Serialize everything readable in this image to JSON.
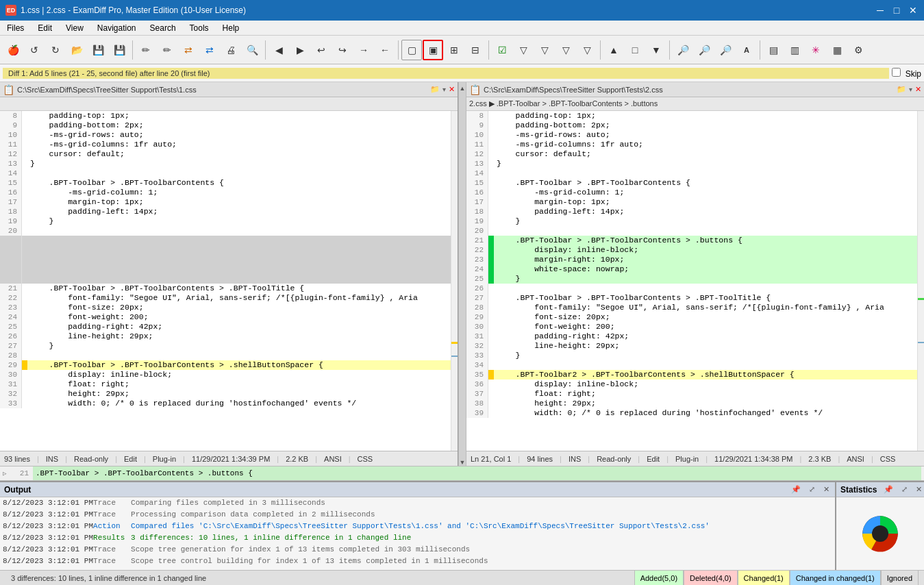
{
  "titlebar": {
    "icon": "ED",
    "title": "1.css | 2.css - ExamDiff Pro, Master Edition (10-User License)",
    "minimize": "─",
    "maximize": "□",
    "close": "✕"
  },
  "menubar": {
    "items": [
      "Files",
      "Edit",
      "View",
      "Navigation",
      "Search",
      "Tools",
      "Help"
    ]
  },
  "toolbar": {
    "buttons": [
      "🍎",
      "↺",
      "↻",
      "📁",
      "💾",
      "💾",
      "✏",
      "✏",
      "🔶",
      "🔷",
      "🖨",
      "🔍",
      "◀",
      "▶",
      "↩",
      "↪",
      "→",
      "←",
      "□",
      "□",
      "▦",
      "▦",
      "▦",
      "▦",
      "☑",
      "▽",
      "▽",
      "▽",
      "▽",
      "▲",
      "□",
      "▼",
      "♦♦",
      "♦♦",
      "♦♦",
      "A",
      "▦",
      "▦",
      "✳",
      "▦",
      "⚙"
    ]
  },
  "diffnav": {
    "label": "Diff 1: Add 5 lines (21 - 25, second file) after line 20 (first file)",
    "skip": "Skip"
  },
  "left_panel": {
    "path": "C:\\Src\\ExamDiff\\Specs\\TreeSitter Support\\Tests\\1.css",
    "breadcrumb": "",
    "lines": [
      {
        "num": 8,
        "content": "    padding-top: 1px;",
        "type": "normal"
      },
      {
        "num": 9,
        "content": "    padding-bottom: 2px;",
        "type": "normal"
      },
      {
        "num": 10,
        "content": "    -ms-grid-rows: auto;",
        "type": "normal"
      },
      {
        "num": 11,
        "content": "    -ms-grid-columns: 1fr auto;",
        "type": "normal"
      },
      {
        "num": 12,
        "content": "    cursor: default;",
        "type": "normal"
      },
      {
        "num": 13,
        "content": "}",
        "type": "normal"
      },
      {
        "num": 14,
        "content": "",
        "type": "normal"
      },
      {
        "num": 15,
        "content": "    .BPT-Toolbar > .BPT-ToolbarContents {",
        "type": "normal"
      },
      {
        "num": 16,
        "content": "        -ms-grid-column: 1;",
        "type": "normal"
      },
      {
        "num": 17,
        "content": "        margin-top: 1px;",
        "type": "normal"
      },
      {
        "num": 18,
        "content": "        padding-left: 14px;",
        "type": "normal"
      },
      {
        "num": 19,
        "content": "    }",
        "type": "normal"
      },
      {
        "num": 20,
        "content": "",
        "type": "normal"
      },
      {
        "num": "",
        "content": "",
        "type": "blank"
      },
      {
        "num": "",
        "content": "",
        "type": "blank"
      },
      {
        "num": "",
        "content": "",
        "type": "blank"
      },
      {
        "num": "",
        "content": "",
        "type": "blank"
      },
      {
        "num": "",
        "content": "",
        "type": "blank"
      },
      {
        "num": 21,
        "content": "    .BPT-Toolbar > .BPT-ToolbarContents > .BPT-ToolTitle {",
        "type": "normal"
      },
      {
        "num": 22,
        "content": "        font-family: \"Segoe UI\", Arial, sans-serif; /*[{plugin-font-family} , Aria",
        "type": "normal"
      },
      {
        "num": 23,
        "content": "        font-size: 20px;",
        "type": "normal"
      },
      {
        "num": 24,
        "content": "        font-weight: 200;",
        "type": "normal"
      },
      {
        "num": 25,
        "content": "        padding-right: 42px;",
        "type": "normal"
      },
      {
        "num": 26,
        "content": "        line-height: 29px;",
        "type": "normal"
      },
      {
        "num": 27,
        "content": "    }",
        "type": "normal"
      },
      {
        "num": 28,
        "content": "",
        "type": "normal"
      },
      {
        "num": 29,
        "content": "    .BPT-Toolbar > .BPT-ToolbarContents > .shellButtonSpacer {",
        "type": "changed"
      },
      {
        "num": 30,
        "content": "        display: inline-block;",
        "type": "normal"
      },
      {
        "num": 31,
        "content": "        float: right;",
        "type": "normal"
      },
      {
        "num": 32,
        "content": "        height: 29px;",
        "type": "normal"
      },
      {
        "num": 33,
        "content": "        width: 0; /* 0 is replaced during 'hostinfochanged' events */",
        "type": "normal"
      }
    ],
    "status": {
      "lines": "93 lines",
      "ins": "INS",
      "readonly": "Read-only",
      "edit": "Edit",
      "plugin": "Plug-in",
      "datetime": "11/29/2021 1:34:39 PM",
      "size": "2.2 KB",
      "encoding": "ANSI",
      "type": "CSS"
    }
  },
  "right_panel": {
    "path": "C:\\Src\\ExamDiff\\Specs\\TreeSitter Support\\Tests\\2.css",
    "breadcrumb": "2.css ▶ .BPT-Toolbar > .BPT-ToolbarContents > .buttons",
    "lines": [
      {
        "num": 8,
        "content": "    padding-top: 1px;",
        "type": "normal"
      },
      {
        "num": 9,
        "content": "    padding-bottom: 2px;",
        "type": "normal"
      },
      {
        "num": 10,
        "content": "    -ms-grid-rows: auto;",
        "type": "normal"
      },
      {
        "num": 11,
        "content": "    -ms-grid-columns: 1fr auto;",
        "type": "normal"
      },
      {
        "num": 12,
        "content": "    cursor: default;",
        "type": "normal"
      },
      {
        "num": 13,
        "content": "}",
        "type": "normal"
      },
      {
        "num": 14,
        "content": "",
        "type": "normal"
      },
      {
        "num": 15,
        "content": "    .BPT-Toolbar > .BPT-ToolbarContents {",
        "type": "normal"
      },
      {
        "num": 16,
        "content": "        -ms-grid-column: 1;",
        "type": "normal"
      },
      {
        "num": 17,
        "content": "        margin-top: 1px;",
        "type": "normal"
      },
      {
        "num": 18,
        "content": "        padding-left: 14px;",
        "type": "normal"
      },
      {
        "num": 19,
        "content": "    }",
        "type": "normal"
      },
      {
        "num": 20,
        "content": "",
        "type": "normal"
      },
      {
        "num": 21,
        "content": "    .BPT-Toolbar > .BPT-ToolbarContents > .buttons {",
        "type": "added"
      },
      {
        "num": 22,
        "content": "        display: inline-block;",
        "type": "added"
      },
      {
        "num": 23,
        "content": "        margin-right: 10px;",
        "type": "added"
      },
      {
        "num": 24,
        "content": "        white-space: nowrap;",
        "type": "added"
      },
      {
        "num": 25,
        "content": "    }",
        "type": "added"
      },
      {
        "num": 26,
        "content": "",
        "type": "normal"
      },
      {
        "num": 27,
        "content": "    .BPT-Toolbar > .BPT-ToolbarContents > .BPT-ToolTitle {",
        "type": "normal"
      },
      {
        "num": 28,
        "content": "        font-family: \"Segoe UI\", Arial, sans-serif; /*[{plugin-font-family} , Aria",
        "type": "normal"
      },
      {
        "num": 29,
        "content": "        font-size: 20px;",
        "type": "normal"
      },
      {
        "num": 30,
        "content": "        font-weight: 200;",
        "type": "normal"
      },
      {
        "num": 31,
        "content": "        padding-right: 42px;",
        "type": "normal"
      },
      {
        "num": 32,
        "content": "        line-height: 29px;",
        "type": "normal"
      },
      {
        "num": 33,
        "content": "    }",
        "type": "normal"
      },
      {
        "num": 34,
        "content": "",
        "type": "normal"
      },
      {
        "num": 35,
        "content": "    .BPT-Toolbar2 > .BPT-ToolbarContents > .shellButtonSpacer {",
        "type": "changed"
      },
      {
        "num": 36,
        "content": "        display: inline-block;",
        "type": "normal"
      },
      {
        "num": 37,
        "content": "        float: right;",
        "type": "normal"
      },
      {
        "num": 38,
        "content": "        height: 29px;",
        "type": "normal"
      },
      {
        "num": 39,
        "content": "        width: 0; /* 0 is replaced during 'hostinfochanged' events */",
        "type": "normal"
      }
    ],
    "status": {
      "position": "Ln 21, Col 1",
      "lines": "94 lines",
      "ins": "INS",
      "readonly": "Read-only",
      "edit": "Edit",
      "plugin": "Plug-in",
      "datetime": "11/29/2021 1:34:38 PM",
      "size": "2.3 KB",
      "encoding": "ANSI",
      "type": "CSS"
    }
  },
  "diff_bottom": {
    "line_num": 21,
    "content": "    .BPT-Toolbar > .BPT-ToolbarContents > .buttons {"
  },
  "output": {
    "title": "Output",
    "rows": [
      {
        "time": "8/12/2023 3:12:01 PM",
        "level": "Trace",
        "msg": "Comparing files completed in 3 milliseconds",
        "style": "trace"
      },
      {
        "time": "8/12/2023 3:12:01 PM",
        "level": "Trace",
        "msg": "Processing comparison data completed in 2 milliseconds",
        "style": "trace"
      },
      {
        "time": "8/12/2023 3:12:01 PM",
        "level": "Action",
        "msg": "Compared files 'C:\\Src\\ExamDiff\\Specs\\TreeSitter Support\\Tests\\1.css' and 'C:\\Src\\ExamDiff\\Specs\\TreeSitter Support\\Tests\\2.css'",
        "style": "action"
      },
      {
        "time": "8/12/2023 3:12:01 PM",
        "level": "Results",
        "msg": "3 differences: 10 lines, 1 inline difference in 1 changed line",
        "style": "results"
      },
      {
        "time": "8/12/2023 3:12:01 PM",
        "level": "Trace",
        "msg": "Scope tree generation for index 1 of 13 items completed in 303 milliseconds",
        "style": "trace"
      },
      {
        "time": "8/12/2023 3:12:01 PM",
        "level": "Trace",
        "msg": "Scope tree control building for index 1 of 13 items completed in 1 milliseconds",
        "style": "trace"
      }
    ]
  },
  "statistics": {
    "title": "Statistics"
  },
  "bottom_status": {
    "text": "3 differences: 10 lines, 1 inline difference in 1 changed line",
    "badges": [
      {
        "label": "Added(5,0)",
        "style": "added"
      },
      {
        "label": "Deleted(4,0)",
        "style": "deleted"
      },
      {
        "label": "Changed(1)",
        "style": "changed"
      },
      {
        "label": "Changed in changed(1)",
        "style": "changed-in"
      },
      {
        "label": "Ignored",
        "style": "ignored"
      }
    ]
  }
}
